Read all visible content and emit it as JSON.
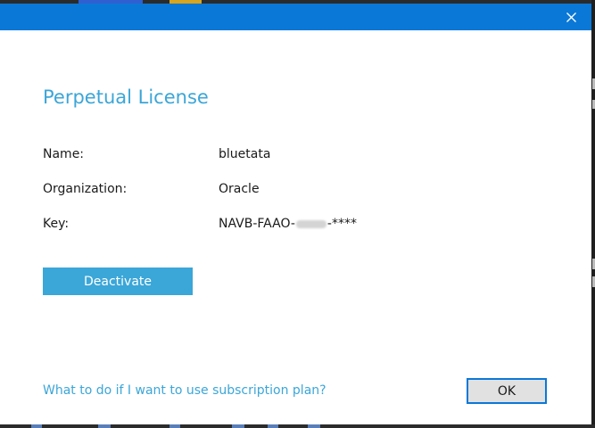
{
  "window": {
    "accent_color": "#0a78d7",
    "close_icon": "close-icon"
  },
  "license": {
    "heading": "Perpetual License",
    "heading_color": "#3ba6d8",
    "fields": {
      "name_label": "Name:",
      "name_value": "bluetata",
      "organization_label": "Organization:",
      "organization_value": "Oracle",
      "key_label": "Key:",
      "key_prefix": "NAVB-FAAO-",
      "key_suffix": "-****"
    }
  },
  "actions": {
    "deactivate_label": "Deactivate",
    "help_link": "What to do if I want to use subscription plan?",
    "ok_label": "OK"
  }
}
